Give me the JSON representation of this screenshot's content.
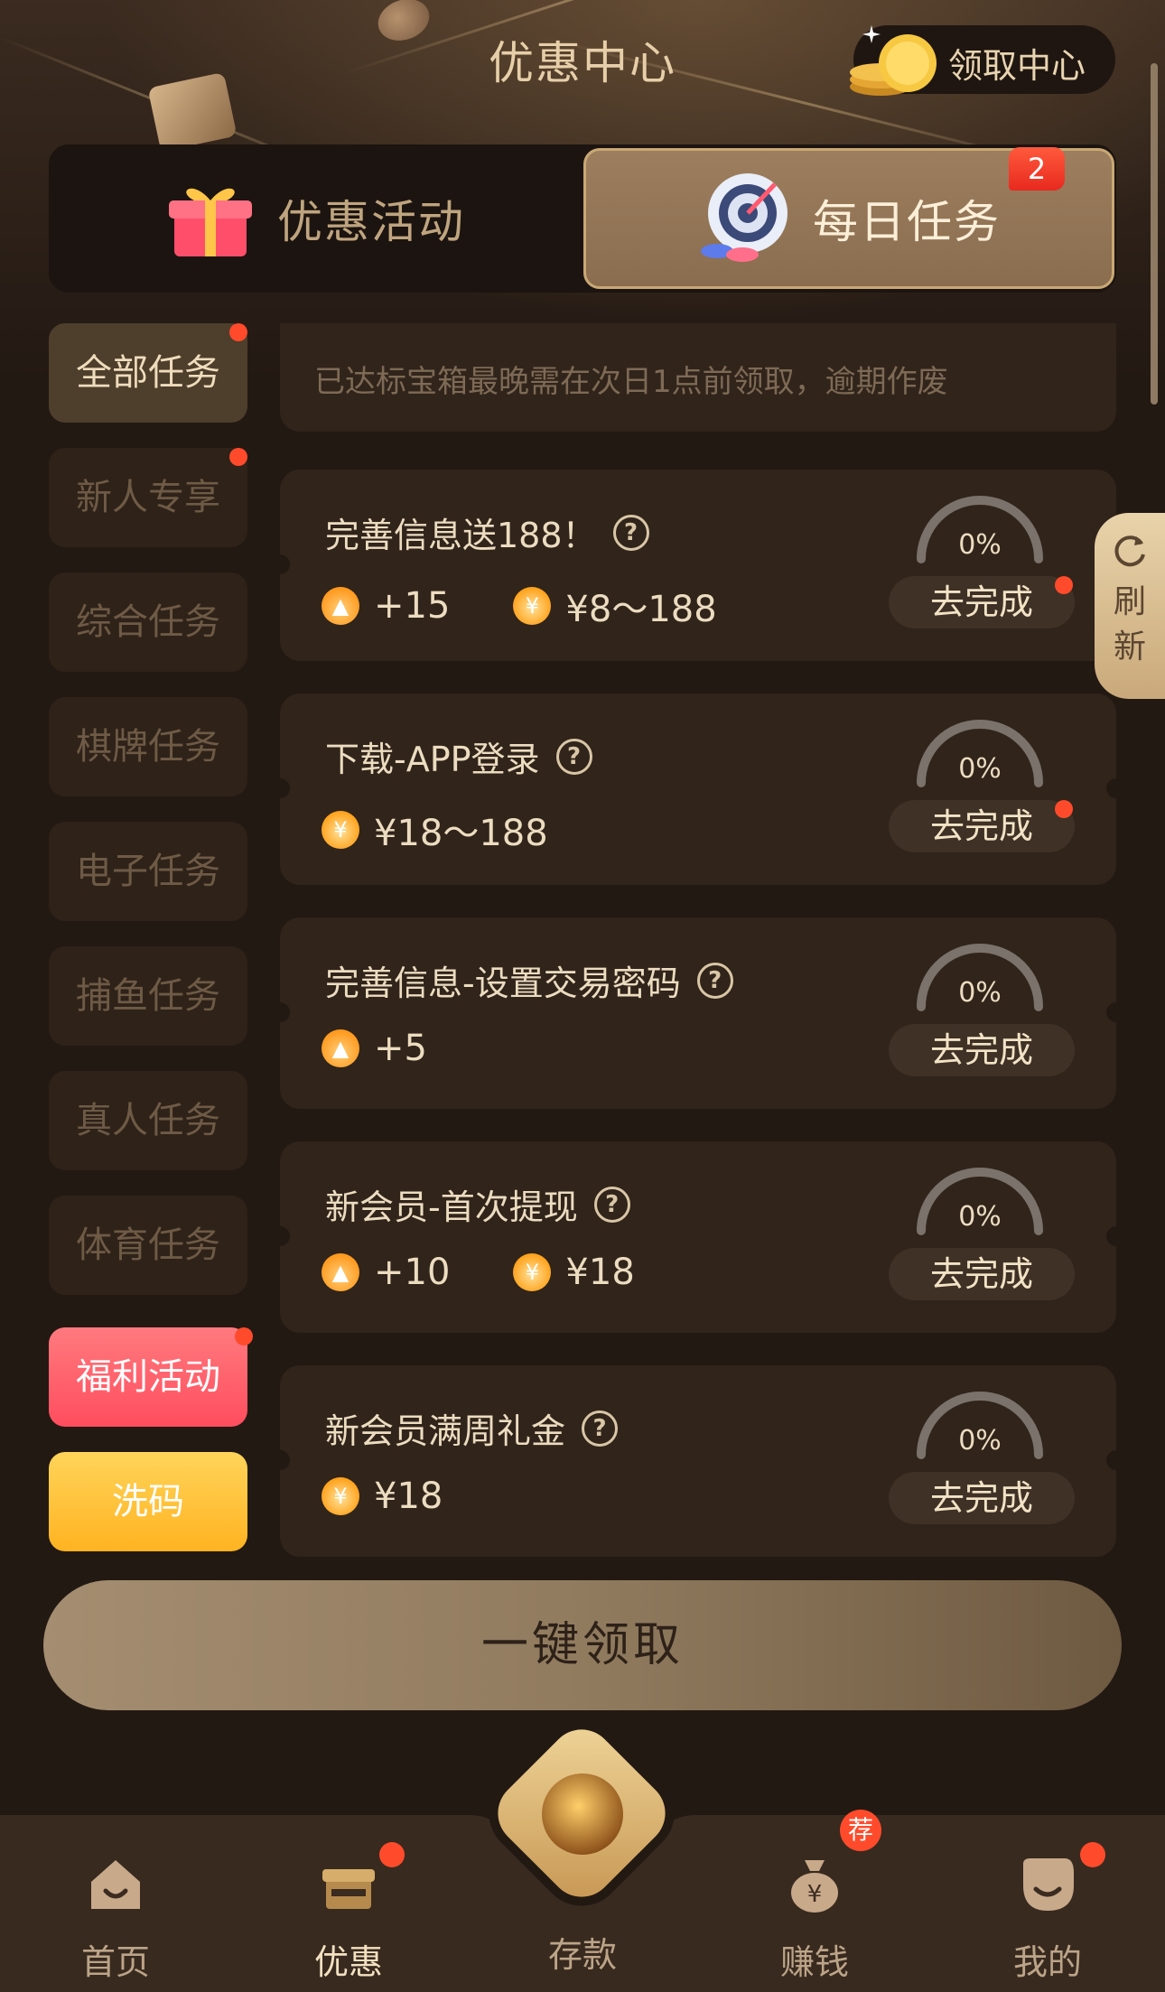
{
  "header": {
    "title": "优惠中心",
    "claim_center_label": "领取中心"
  },
  "tabs": {
    "promo_label": "优惠活动",
    "daily_label": "每日任务",
    "daily_badge": "2"
  },
  "sidebar": {
    "items": [
      {
        "label": "全部任务"
      },
      {
        "label": "新人专享"
      },
      {
        "label": "综合任务"
      },
      {
        "label": "棋牌任务"
      },
      {
        "label": "电子任务"
      },
      {
        "label": "捕鱼任务"
      },
      {
        "label": "真人任务"
      },
      {
        "label": "体育任务"
      },
      {
        "label": "福利活动"
      },
      {
        "label": "洗码"
      }
    ]
  },
  "notice": "已达标宝箱最晚需在次日1点前领取，逾期作废",
  "tasks": [
    {
      "title": "完善信息送188！",
      "fire": "+15",
      "money": "¥8～188",
      "progress": "0%",
      "action": "去完成"
    },
    {
      "title": "下载-APP登录",
      "money": "¥18～188",
      "progress": "0%",
      "action": "去完成"
    },
    {
      "title": "完善信息-设置交易密码",
      "fire": "+5",
      "progress": "0%",
      "action": "去完成"
    },
    {
      "title": "新会员-首次提现",
      "fire": "+10",
      "money": "¥18",
      "progress": "0%",
      "action": "去完成"
    },
    {
      "title": "新会员满周礼金",
      "money": "¥18",
      "progress": "0%",
      "action": "去完成"
    }
  ],
  "refresh": {
    "line1": "刷",
    "line2": "新"
  },
  "claim_all_label": "一键领取",
  "tabbar": {
    "home": "首页",
    "promo": "优惠",
    "deposit": "存款",
    "earn": "赚钱",
    "earn_badge": "荐",
    "mine": "我的"
  },
  "colors": {
    "background": "#231913",
    "card": "#30241b",
    "accent_gold": "#c9a874",
    "badge_red": "#ff4b2b",
    "welfare_pink": "#ff5a66",
    "wash_yellow": "#ffc13a"
  }
}
